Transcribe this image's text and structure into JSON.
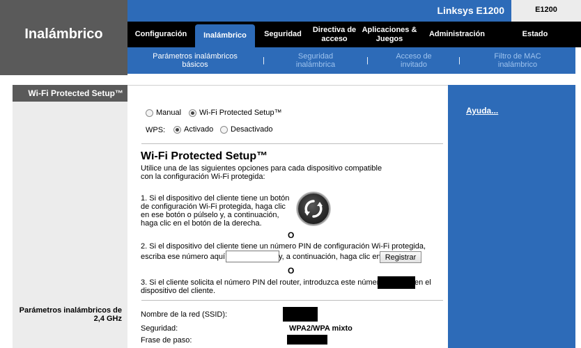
{
  "header": {
    "brand": "Linksys E1200",
    "model": "E1200",
    "section_title": "Inalámbrico"
  },
  "tabs": [
    {
      "label": "Configuración"
    },
    {
      "label": "Inalámbrico",
      "active": true
    },
    {
      "label": "Seguridad"
    },
    {
      "label": "Directiva de acceso"
    },
    {
      "label": "Aplicaciones & Juegos"
    },
    {
      "label": "Administración"
    },
    {
      "label": "Estado"
    }
  ],
  "subtabs": [
    {
      "label": "Parámetros inalámbricos básicos",
      "current": true
    },
    {
      "label": "Seguridad inalámbrica"
    },
    {
      "label": "Acceso de invitado"
    },
    {
      "label": "Filtro de MAC inalámbrico"
    }
  ],
  "subtab_separator": "|",
  "left": {
    "heading": "Wi-Fi Protected Setup™",
    "section_label": "Parámetros inalámbricos de 2,4 GHz"
  },
  "mode": {
    "manual_label": "Manual",
    "wps_label": "Wi-Fi Protected Setup™",
    "selected": "Wi-Fi Protected Setup™"
  },
  "wps": {
    "label": "WPS:",
    "enabled_label": "Activado",
    "disabled_label": "Desactivado",
    "selected": "Activado"
  },
  "content": {
    "title": "Wi-Fi Protected Setup™",
    "intro_line1": "Utilice una de las siguientes opciones para cada dispositivo compatible",
    "intro_line2": "con la configuración Wi-Fi protegida:",
    "opt1_line1": "1. Si el dispositivo del cliente tiene un botón",
    "opt1_line2": "de configuración Wi-Fi protegida, haga clic",
    "opt1_line3": "en ese botón o púlselo y, a continuación,",
    "opt1_line4": "haga clic en el botón de la derecha.",
    "or_label": "O",
    "opt2_line1": "2. Si el dispositivo del cliente tiene un número PIN de configuración Wi-Fi protegida,",
    "opt2_prefix": "escriba ese número aquí",
    "opt2_suffix": "y, a continuación, haga clic en",
    "pin_value": "",
    "register_label": "Registrar",
    "opt3_line1_prefix": "3. Si el cliente solicita el número PIN del router, introduzca este número",
    "opt3_line1_suffix": "en el",
    "opt3_line2": "dispositivo del cliente.",
    "ssid_label": "Nombre de la red (SSID):",
    "security_label": "Seguridad:",
    "security_value": "WPA2/WPA mixto",
    "passphrase_label": "Frase de paso:"
  },
  "help": {
    "label": "Ayuda..."
  },
  "colors": {
    "brand_blue": "#2d6bb8",
    "dark_gray": "#5a5a5a",
    "light_gray": "#ececec",
    "nav_black": "#000000"
  }
}
